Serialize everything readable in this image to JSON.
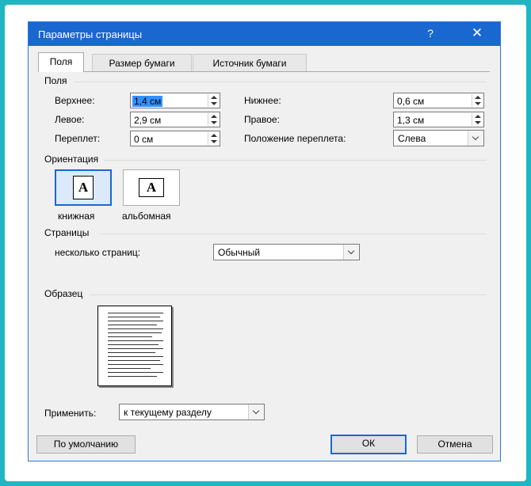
{
  "dialog": {
    "title": "Параметры страницы",
    "help_icon": "question-mark-icon",
    "help_glyph": "?",
    "close_icon": "close-icon",
    "close_glyph": "✕"
  },
  "tabs": [
    {
      "label": "Поля",
      "active": true
    },
    {
      "label": "Размер бумаги",
      "active": false
    },
    {
      "label": "Источник бумаги",
      "active": false
    }
  ],
  "margins": {
    "group_label": "Поля",
    "top": {
      "label": "Верхнее:",
      "value": "1,4 см"
    },
    "bottom": {
      "label": "Нижнее:",
      "value": "0,6 см"
    },
    "left": {
      "label": "Левое:",
      "value": "2,9 см"
    },
    "right": {
      "label": "Правое:",
      "value": "1,3 см"
    },
    "gutter": {
      "label": "Переплет:",
      "value": "0 см"
    },
    "gutter_pos": {
      "label": "Положение переплета:",
      "value": "Слева"
    }
  },
  "orientation": {
    "group_label": "Ориентация",
    "portrait": {
      "label": "книжная",
      "glyph": "A",
      "icon": "portrait-orientation-icon",
      "selected": true
    },
    "landscape": {
      "label": "альбомная",
      "glyph": "A",
      "icon": "landscape-orientation-icon",
      "selected": false
    }
  },
  "pages": {
    "group_label": "Страницы",
    "multiple_label": "несколько страниц:",
    "multiple_value": "Обычный"
  },
  "preview": {
    "group_label": "Образец"
  },
  "apply": {
    "label": "Применить:",
    "value": "к текущему разделу"
  },
  "buttons": {
    "default": "По умолчанию",
    "ok": "ОК",
    "cancel": "Отмена"
  },
  "colors": {
    "accent": "#1a67d0",
    "frame_border": "#1fb6c2"
  }
}
